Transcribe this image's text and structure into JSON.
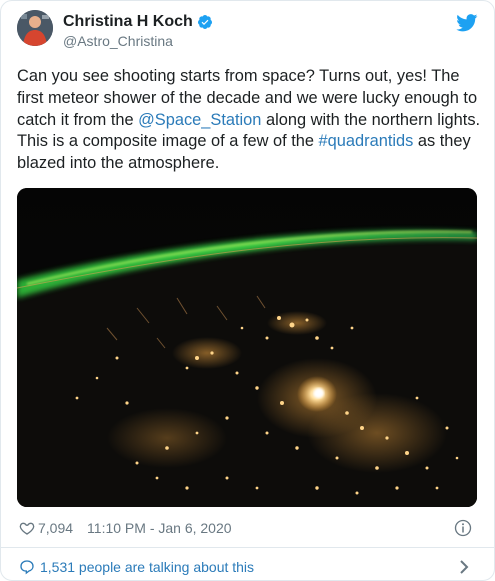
{
  "author": {
    "display_name": "Christina H Koch",
    "handle": "@Astro_Christina"
  },
  "tweet": {
    "line1": "Can you see shooting starts from space? Turns out, yes! The",
    "line2": "first meteor shower of the decade and we were lucky enough to",
    "line3_before": "catch it from the ",
    "mention": "@Space_Station",
    "line3_after": " along with the northern lights.",
    "line4_before": "This is a composite image of a few of the ",
    "hashtag": "#quadrantids",
    "line4_after": " as they",
    "line5": "blazed into the atmosphere."
  },
  "meta": {
    "likes": "7,094",
    "timestamp": "11:10 PM - Jan 6, 2020"
  },
  "footer": {
    "talking": "1,531 people are talking about this"
  },
  "icons": {
    "verified": "verified-badge-icon",
    "brand": "twitter-bird-icon",
    "like": "heart-icon",
    "info": "info-icon",
    "reply": "speech-bubble-icon",
    "more": "chevron-right-icon"
  },
  "colors": {
    "text": "#1c2022",
    "secondary": "#697882",
    "link": "#2b7bb9",
    "brand": "#1da1f2"
  }
}
